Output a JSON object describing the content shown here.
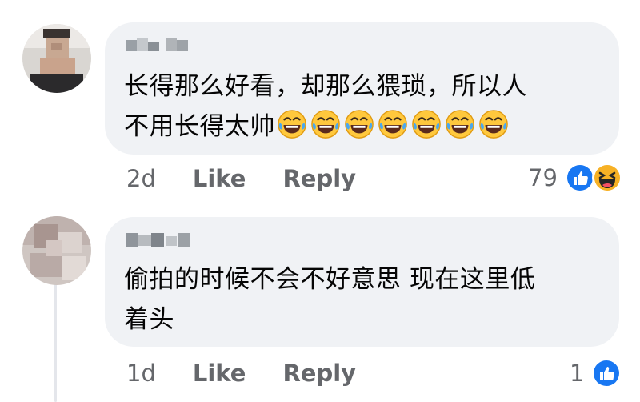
{
  "comments": [
    {
      "text": "长得那么好看，却那么猥琐，所以人\n不用长得太帅",
      "emoji": [
        "😂",
        "😂",
        "😂",
        "😂",
        "😂",
        "😂",
        "😂"
      ],
      "time": "2d",
      "like_label": "Like",
      "reply_label": "Reply",
      "reaction_count": "79",
      "reactions": [
        "like-icon",
        "haha-icon"
      ]
    },
    {
      "text": "偷拍的时候不会不好意思 现在这里低\n着头",
      "time": "1d",
      "like_label": "Like",
      "reply_label": "Reply",
      "reaction_count": "1",
      "reactions": [
        "like-icon"
      ]
    }
  ],
  "colors": {
    "bubble": "#f0f2f5",
    "meta_text": "#65676b",
    "like_blue": "#1877f2",
    "haha_yellow": "#f7b125"
  }
}
